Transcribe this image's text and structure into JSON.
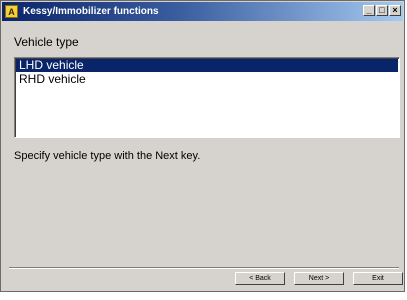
{
  "window": {
    "title": "Kessy/Immobilizer functions",
    "app_icon_glyph": "A",
    "controls": {
      "minimize": "_",
      "maximize": "□",
      "close": "×"
    }
  },
  "main": {
    "heading": "Vehicle type",
    "list": {
      "items": [
        "LHD vehicle",
        "RHD vehicle"
      ],
      "selected": "LHD vehicle"
    },
    "hint": "Specify vehicle type with the Next key."
  },
  "footer": {
    "back_label": "< Back",
    "next_label": "Next >",
    "exit_label": "Exit"
  },
  "colors": {
    "selection": "#0a246a",
    "dialog_bg": "#d6d3ce"
  }
}
